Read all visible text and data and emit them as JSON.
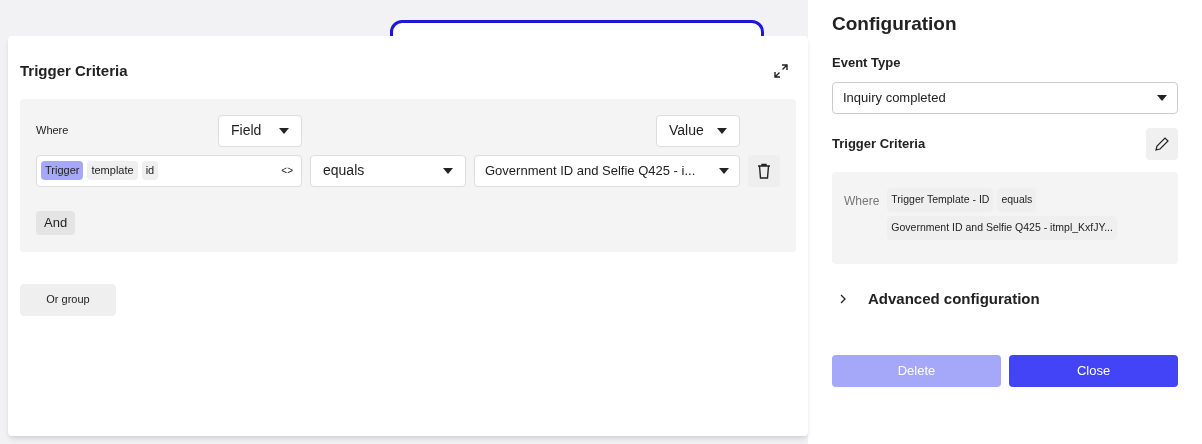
{
  "modal": {
    "title": "Trigger Criteria",
    "where_label": "Where",
    "field_select": "Field",
    "value_select": "Value",
    "condition": {
      "path_tokens": [
        {
          "text": "Trigger",
          "highlighted": true
        },
        {
          "text": "template",
          "highlighted": false
        },
        {
          "text": "id",
          "highlighted": false
        }
      ],
      "code_toggle": "<>",
      "operator": "equals",
      "value": "Government ID and Selfie Q425 - i..."
    },
    "and_button": "And",
    "or_group_button": "Or group"
  },
  "panel": {
    "title": "Configuration",
    "event_type_label": "Event Type",
    "event_type_value": "Inquiry completed",
    "trigger_criteria_label": "Trigger Criteria",
    "summary": {
      "where_label": "Where",
      "chips": [
        "Trigger Template - ID",
        "equals",
        "Government ID and Selfie Q425 - itmpl_KxfJY..."
      ]
    },
    "advanced": {
      "label": "Advanced configuration",
      "expanded": false
    },
    "buttons": [
      {
        "label": "Delete",
        "disabled": true
      },
      {
        "label": "Close",
        "disabled": false
      }
    ]
  }
}
